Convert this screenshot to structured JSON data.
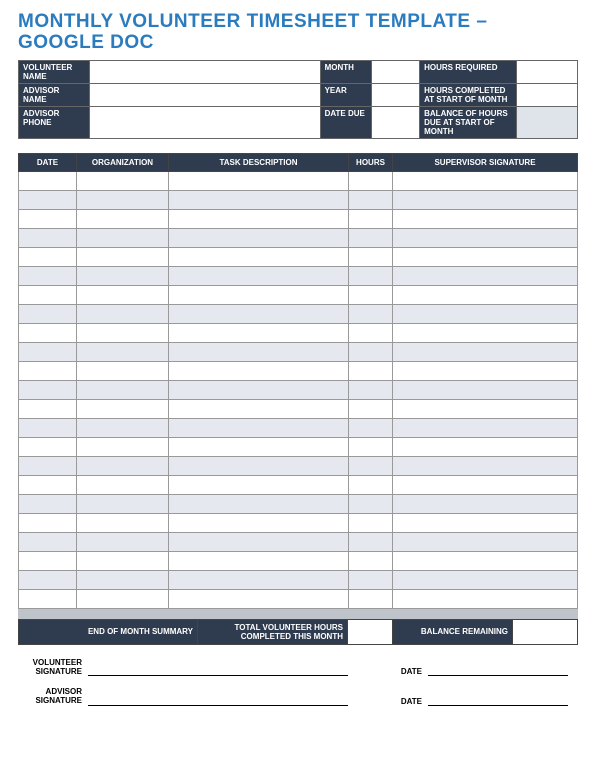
{
  "title_line1": "MONTHLY VOLUNTEER TIMESHEET TEMPLATE  –",
  "title_line2": "GOOGLE DOC",
  "info": {
    "volunteer_name_label": "VOLUNTEER NAME",
    "advisor_name_label": "ADVISOR NAME",
    "advisor_phone_label": "ADVISOR PHONE",
    "month_label": "MONTH",
    "year_label": "YEAR",
    "date_due_label": "DATE DUE",
    "hours_required_label": "HOURS REQUIRED",
    "hours_completed_label": "HOURS COMPLETED AT START OF MONTH",
    "balance_due_label": "BALANCE OF HOURS DUE AT START OF MONTH",
    "volunteer_name": "",
    "advisor_name": "",
    "advisor_phone": "",
    "month": "",
    "year": "",
    "date_due": "",
    "hours_required": "",
    "hours_completed": "",
    "balance_due": ""
  },
  "columns": {
    "date": "DATE",
    "organization": "ORGANIZATION",
    "task": "TASK DESCRIPTION",
    "hours": "HOURS",
    "signature": "SUPERVISOR SIGNATURE"
  },
  "rows": [
    {
      "date": "",
      "org": "",
      "task": "",
      "hrs": "",
      "sig": ""
    },
    {
      "date": "",
      "org": "",
      "task": "",
      "hrs": "",
      "sig": ""
    },
    {
      "date": "",
      "org": "",
      "task": "",
      "hrs": "",
      "sig": ""
    },
    {
      "date": "",
      "org": "",
      "task": "",
      "hrs": "",
      "sig": ""
    },
    {
      "date": "",
      "org": "",
      "task": "",
      "hrs": "",
      "sig": ""
    },
    {
      "date": "",
      "org": "",
      "task": "",
      "hrs": "",
      "sig": ""
    },
    {
      "date": "",
      "org": "",
      "task": "",
      "hrs": "",
      "sig": ""
    },
    {
      "date": "",
      "org": "",
      "task": "",
      "hrs": "",
      "sig": ""
    },
    {
      "date": "",
      "org": "",
      "task": "",
      "hrs": "",
      "sig": ""
    },
    {
      "date": "",
      "org": "",
      "task": "",
      "hrs": "",
      "sig": ""
    },
    {
      "date": "",
      "org": "",
      "task": "",
      "hrs": "",
      "sig": ""
    },
    {
      "date": "",
      "org": "",
      "task": "",
      "hrs": "",
      "sig": ""
    },
    {
      "date": "",
      "org": "",
      "task": "",
      "hrs": "",
      "sig": ""
    },
    {
      "date": "",
      "org": "",
      "task": "",
      "hrs": "",
      "sig": ""
    },
    {
      "date": "",
      "org": "",
      "task": "",
      "hrs": "",
      "sig": ""
    },
    {
      "date": "",
      "org": "",
      "task": "",
      "hrs": "",
      "sig": ""
    },
    {
      "date": "",
      "org": "",
      "task": "",
      "hrs": "",
      "sig": ""
    },
    {
      "date": "",
      "org": "",
      "task": "",
      "hrs": "",
      "sig": ""
    },
    {
      "date": "",
      "org": "",
      "task": "",
      "hrs": "",
      "sig": ""
    },
    {
      "date": "",
      "org": "",
      "task": "",
      "hrs": "",
      "sig": ""
    },
    {
      "date": "",
      "org": "",
      "task": "",
      "hrs": "",
      "sig": ""
    },
    {
      "date": "",
      "org": "",
      "task": "",
      "hrs": "",
      "sig": ""
    },
    {
      "date": "",
      "org": "",
      "task": "",
      "hrs": "",
      "sig": ""
    }
  ],
  "summary": {
    "eom_label": "END OF MONTH SUMMARY",
    "total_hours_label": "TOTAL VOLUNTEER HOURS COMPLETED THIS MONTH",
    "balance_remaining_label": "BALANCE REMAINING",
    "total_hours": "",
    "balance_remaining": ""
  },
  "signatures": {
    "volunteer_label": "VOLUNTEER SIGNATURE",
    "advisor_label": "ADVISOR SIGNATURE",
    "date_label": "DATE"
  }
}
